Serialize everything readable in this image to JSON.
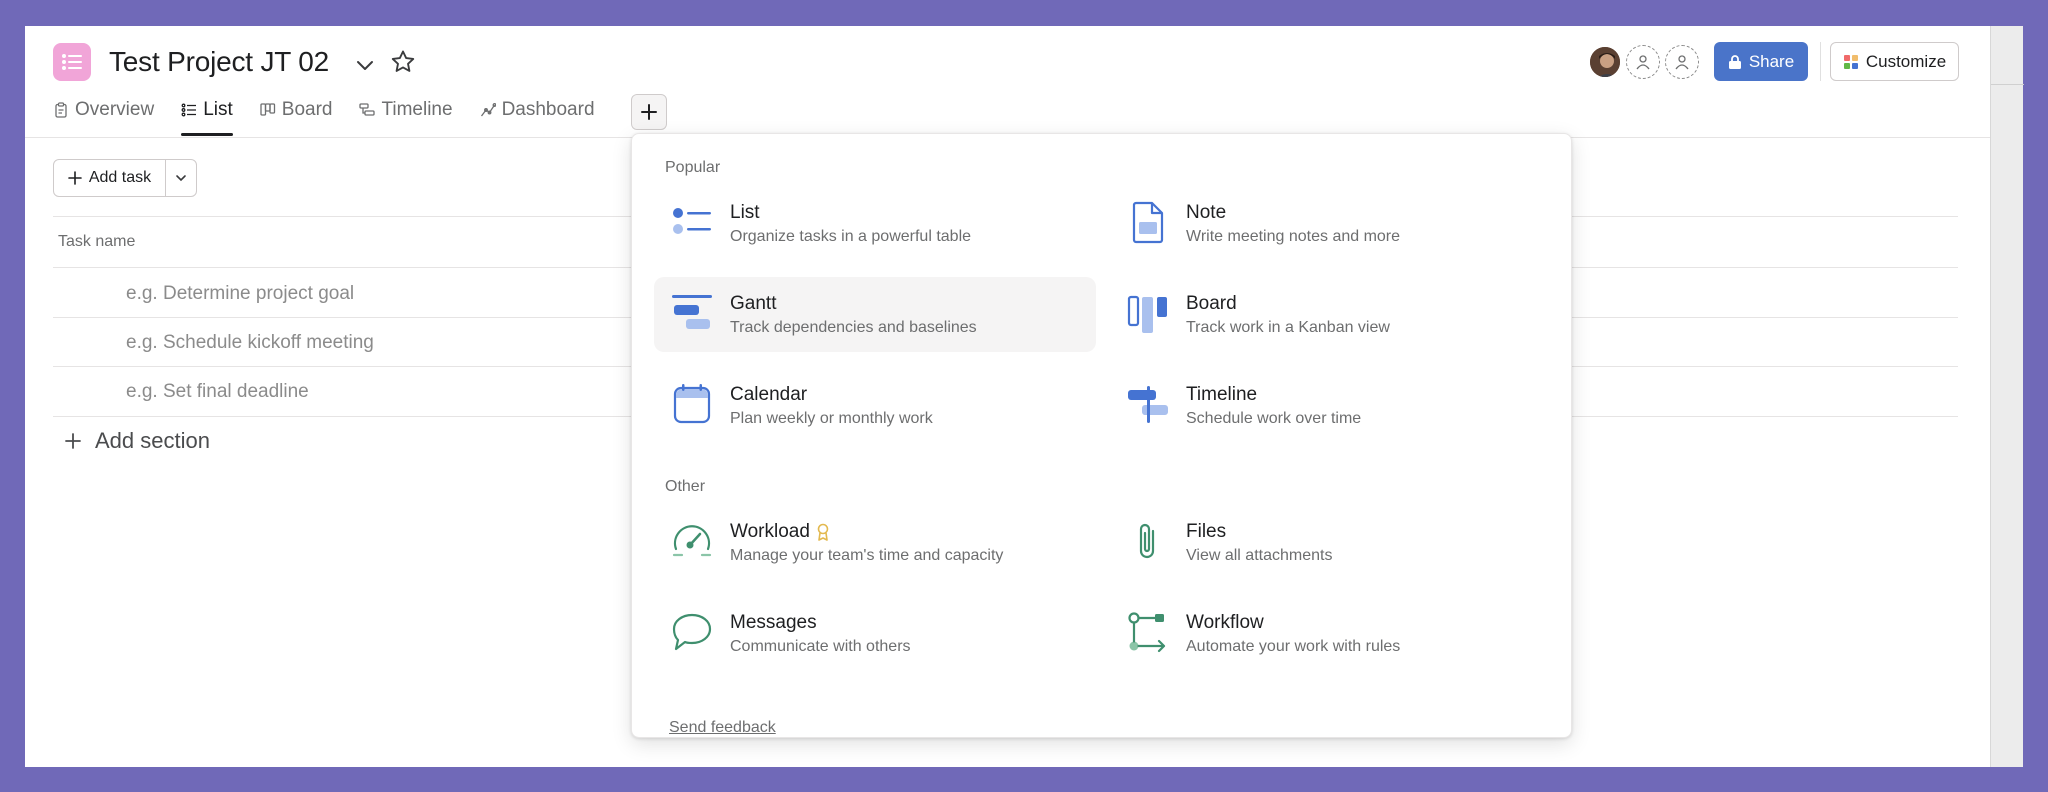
{
  "project": {
    "title": "Test Project JT 02"
  },
  "header": {
    "share_label": "Share",
    "customize_label": "Customize"
  },
  "tabs": [
    {
      "label": "Overview",
      "icon": "clipboard-icon"
    },
    {
      "label": "List",
      "icon": "list-icon",
      "active": true
    },
    {
      "label": "Board",
      "icon": "board-icon"
    },
    {
      "label": "Timeline",
      "icon": "timeline-icon"
    },
    {
      "label": "Dashboard",
      "icon": "dashboard-icon"
    }
  ],
  "list": {
    "add_task_label": "Add task",
    "column_header": "Task name",
    "placeholders": [
      "e.g. Determine project goal",
      "e.g. Schedule kickoff meeting",
      "e.g. Set final deadline"
    ],
    "add_section_label": "Add section"
  },
  "menu": {
    "popular_label": "Popular",
    "other_label": "Other",
    "items": [
      {
        "title": "List",
        "desc": "Organize tasks in a powerful table",
        "icon": "list-view-icon"
      },
      {
        "title": "Note",
        "desc": "Write meeting notes and more",
        "icon": "note-icon"
      },
      {
        "title": "Gantt",
        "desc": "Track dependencies and baselines",
        "icon": "gantt-icon"
      },
      {
        "title": "Board",
        "desc": "Track work in a Kanban view",
        "icon": "board-view-icon"
      },
      {
        "title": "Calendar",
        "desc": "Plan weekly or monthly work",
        "icon": "calendar-icon"
      },
      {
        "title": "Timeline",
        "desc": "Schedule work over time",
        "icon": "timeline-view-icon"
      },
      {
        "title": "Workload",
        "desc": "Manage your team's time and capacity",
        "icon": "gauge-icon"
      },
      {
        "title": "Files",
        "desc": "View all attachments",
        "icon": "paperclip-icon"
      },
      {
        "title": "Messages",
        "desc": "Communicate with others",
        "icon": "chat-bubble-icon"
      },
      {
        "title": "Workflow",
        "desc": "Automate your work with rules",
        "icon": "workflow-icon"
      }
    ],
    "feedback_label": "Send feedback"
  },
  "colors": {
    "background": "#7069b8",
    "share_blue": "#4a74c9",
    "project_icon_pink": "#f1a5d8",
    "popular_icon_blue": "#4573d2",
    "other_icon_green": "#3f8f6e"
  }
}
